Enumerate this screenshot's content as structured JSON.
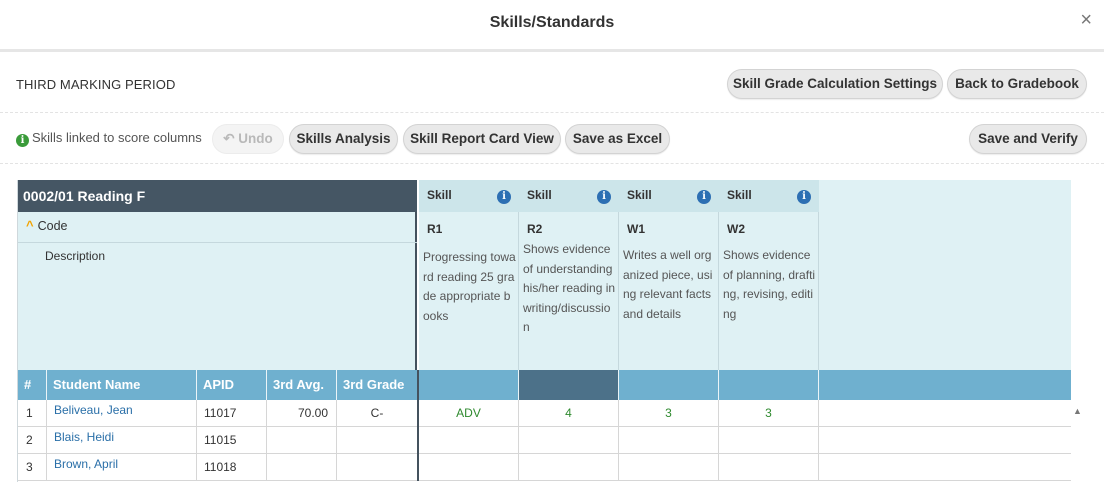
{
  "modal": {
    "title": "Skills/Standards",
    "close": "×"
  },
  "period": {
    "title": "THIRD MARKING PERIOD"
  },
  "buttons": {
    "calc_settings": "Skill Grade Calculation Settings",
    "back_gradebook": "Back to Gradebook",
    "undo": "Undo",
    "skills_analysis": "Skills Analysis",
    "report_card_view": "Skill Report Card View",
    "save_excel": "Save as Excel",
    "save_verify": "Save and Verify"
  },
  "toolbar": {
    "linked_info": "Skills linked to score columns",
    "info_icon": "info-circle-icon"
  },
  "grid": {
    "class_title": "0002/01 Reading F",
    "code_label": "Code",
    "description_label": "Description",
    "skills": [
      {
        "head": "Skill",
        "code": "R1",
        "description": "Progressing toward reading 25 grade appropriate books"
      },
      {
        "head": "Skill",
        "code": "R2",
        "description": "Shows evidence of understanding his/her reading in writing/discussion"
      },
      {
        "head": "Skill",
        "code": "W1",
        "description": "Writes a well organized piece, using relevant facts and details"
      },
      {
        "head": "Skill",
        "code": "W2",
        "description": "Shows evidence of planning, drafting, revising, editing"
      }
    ],
    "columns": [
      "#",
      "Student Name",
      "APID",
      "3rd Avg.",
      "3rd Grade"
    ],
    "rows": [
      {
        "num": "1",
        "name": "Beliveau, Jean",
        "apid": "11017",
        "avg": "70.00",
        "grade": "C-",
        "skills": [
          "ADV",
          "4",
          "3",
          "3"
        ]
      },
      {
        "num": "2",
        "name": "Blais, Heidi",
        "apid": "11015",
        "avg": "",
        "grade": "",
        "skills": [
          "",
          "",
          "",
          ""
        ]
      },
      {
        "num": "3",
        "name": "Brown, April",
        "apid": "11018",
        "avg": "",
        "grade": "",
        "skills": [
          "",
          "",
          "",
          ""
        ]
      }
    ]
  }
}
